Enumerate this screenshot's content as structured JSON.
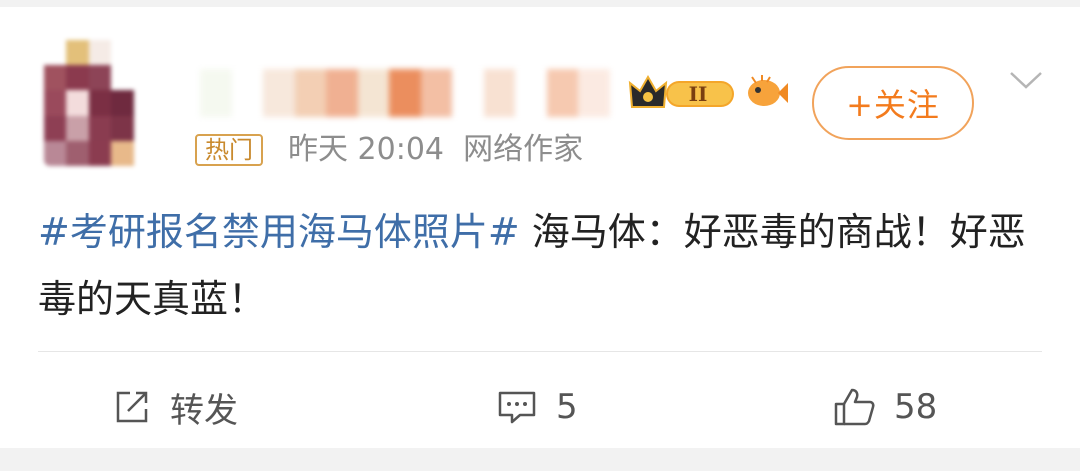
{
  "post": {
    "hot_tag": "热门",
    "time_source": "昨天 20:04  网络作家",
    "follow_label": "+关注",
    "level_badge": "II",
    "hashtag": "#考研报名禁用海马体照片#",
    "text": " 海马体：好恶毒的商战！好恶毒的天真蓝！"
  },
  "actions": {
    "repost_label": "转发",
    "comment_count": "5",
    "like_count": "58"
  },
  "colors": {
    "accent": "#f37b1d",
    "hashtag": "#3f6ea8",
    "meta": "#8d8d8d"
  },
  "icons": [
    "crown-level-icon",
    "fish-badge-icon",
    "chevron-down-icon",
    "repost-icon",
    "comment-icon",
    "like-icon"
  ]
}
